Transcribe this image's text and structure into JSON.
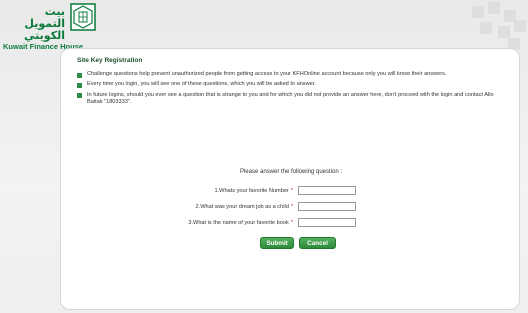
{
  "header": {
    "logo_arabic": "بيت التمويل الكويتي",
    "logo_english": "Kuwait Finance House",
    "brand_color": "#0a7a3a"
  },
  "panel": {
    "title": "Site Key Registration",
    "bullets": [
      "Challenge questions help prevent unauthorized people from getting access to your KFHOnline account because only you will know their answers.",
      "Every time you login, you will see one of these questions, which you will be asked to answer.",
      "In future logins, should you ever see a question that is strange to you and for which you did not provide an answer here, don't proceed with the login and contact Allo Baitak \"1803333\"."
    ],
    "prompt": "Please answer the following question :",
    "questions": [
      {
        "label": "1.Whats your favorite Number",
        "required_mark": "*",
        "value": ""
      },
      {
        "label": "2.What was your dream job as a child",
        "required_mark": "*",
        "value": ""
      },
      {
        "label": "3.What is the name of your favorite book",
        "required_mark": "*",
        "value": ""
      }
    ],
    "submit_label": "Submit",
    "cancel_label": "Cancel",
    "accent_color": "#2f8a45"
  }
}
